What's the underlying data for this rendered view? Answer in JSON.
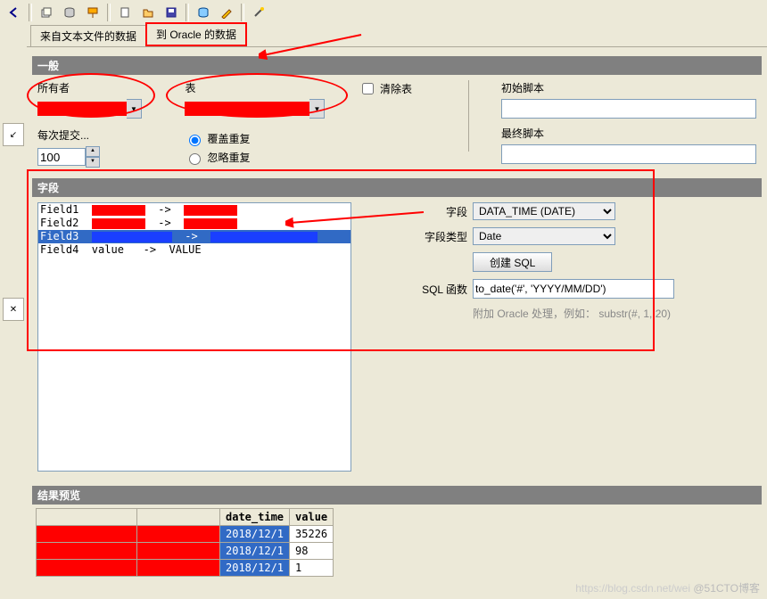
{
  "toolbar_icons": [
    "left-arrow",
    "clipboard",
    "db",
    "brush",
    "sep",
    "new",
    "open",
    "save",
    "sep",
    "db-cyl",
    "pencil",
    "sep",
    "wand"
  ],
  "tabs": {
    "text_file": "来自文本文件的数据",
    "oracle": "到 Oracle 的数据"
  },
  "general": {
    "header": "一般",
    "owner_label": "所有者",
    "table_label": "表",
    "commit_every_label": "每次提交...",
    "commit_every_value": "100",
    "overwrite_label": "覆盖重复",
    "ignore_label": "忽略重复",
    "overwrite_checked": true,
    "clear_table_label": "清除表",
    "init_script_label": "初始脚本",
    "final_script_label": "最终脚本"
  },
  "fields": {
    "header": "字段",
    "rows": [
      {
        "name": "Field1",
        "arrow": "->",
        "redact": "red",
        "redact2": "red"
      },
      {
        "name": "Field2",
        "arrow": "->",
        "redact": "red",
        "redact2": "red"
      },
      {
        "name": "Field3",
        "arrow": "->",
        "redact": "blue",
        "redact2": "blue",
        "selected": true
      },
      {
        "name": "Field4",
        "mid": "value",
        "arrow": "->",
        "target": "VALUE"
      }
    ],
    "field_label": "字段",
    "field_value": "DATA_TIME (DATE)",
    "type_label": "字段类型",
    "type_value": "Date",
    "create_sql_btn": "创建 SQL",
    "sql_func_label": "SQL 函数",
    "sql_func_value": "to_date('#', 'YYYY/MM/DD')",
    "sql_hint": "附加 Oracle 处理，例如：  substr(#, 1, 20)"
  },
  "preview": {
    "header": "结果预览",
    "cols": [
      "",
      "",
      "date_time",
      "value"
    ],
    "rows": [
      [
        "",
        "",
        "2018/12/1",
        "35226"
      ],
      [
        "",
        "",
        "2018/12/1",
        "98"
      ],
      [
        "",
        "",
        "2018/12/1",
        "1"
      ]
    ]
  },
  "watermark": "@51CTO博客",
  "watermark2": "https://blog.csdn.net/wei"
}
